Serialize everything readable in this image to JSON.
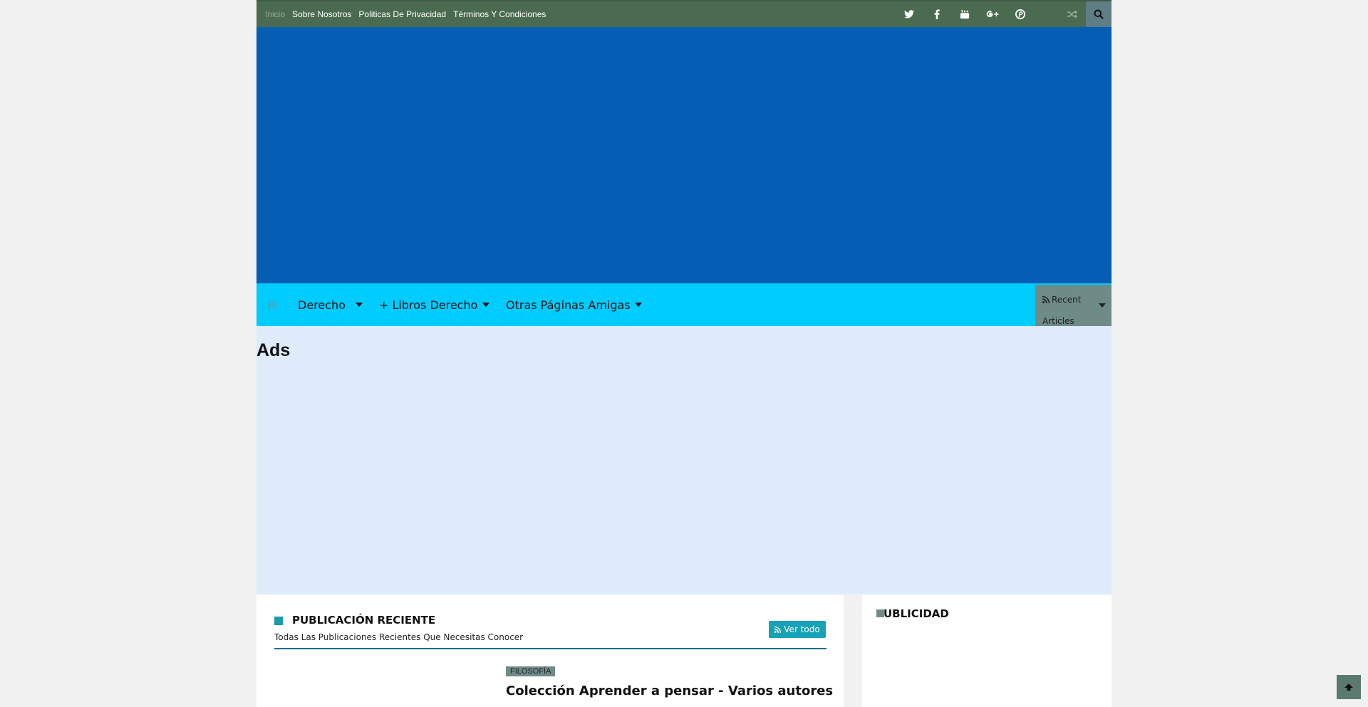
{
  "topbar": {
    "links": [
      "Inicio",
      "Sobre Nosotros",
      "Politicas De Privacidad",
      "Términos Y Condiciones"
    ],
    "social_icons": [
      "twitter-icon",
      "facebook-icon",
      "youtube-icon",
      "google-plus-icon",
      "pinterest-icon"
    ],
    "background": "#4a6b50"
  },
  "header": {
    "background": "#055eb4"
  },
  "mainnav": {
    "items": [
      "Derecho",
      "+ Libros Derecho",
      "Otras Páginas Amigas"
    ],
    "recent_label": "Recent Articles",
    "background": "#00ccff"
  },
  "ads": {
    "title": "Ads"
  },
  "recent_section": {
    "title": "PUBLICACIÓN RECIENTE",
    "subtitle": "Todas Las Publicaciones Recientes Que Necesitas Conocer",
    "view_all": "Ver todo",
    "first_post": {
      "category": "FILOSOFÍA",
      "title": "Colección Aprender a pensar - Varios autores"
    }
  },
  "sidebar": {
    "widget_title": "UBLICIDAD"
  }
}
